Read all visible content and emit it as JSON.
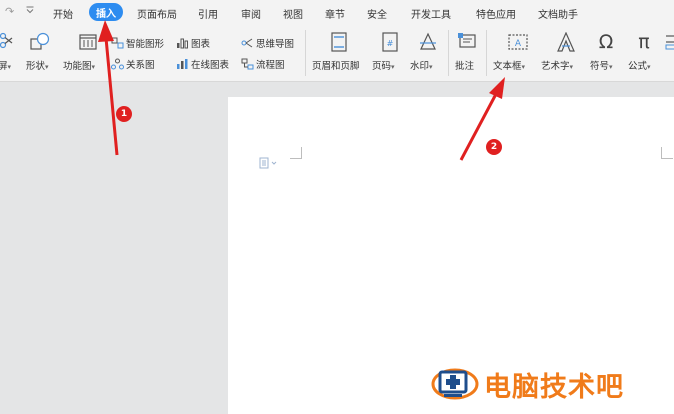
{
  "menu": {
    "items": [
      "开始",
      "插入",
      "页面布局",
      "引用",
      "审阅",
      "视图",
      "章节",
      "安全",
      "开发工具",
      "特色应用",
      "文档助手"
    ],
    "active_index": 1
  },
  "ribbon": {
    "screenshot_label": "屏",
    "shape_label": "形状",
    "function_chart_label": "功能图",
    "smart_graphic_label": "智能图形",
    "relation_label": "关系图",
    "chart_label": "图表",
    "online_chart_label": "在线图表",
    "mindmap_label": "思维导图",
    "flowchart_label": "流程图",
    "header_footer_label": "页眉和页脚",
    "page_number_label": "页码",
    "watermark_label": "水印",
    "comment_label": "批注",
    "textbox_label": "文本框",
    "wordart_label": "艺术字",
    "symbol_label": "符号",
    "formula_label": "公式",
    "dropdown_arrow": "▾"
  },
  "annotations": {
    "badge1": "1",
    "badge2": "2",
    "color": "#e02020"
  },
  "watermark": {
    "text": "电脑技术吧",
    "color": "#f07b1a"
  },
  "colors": {
    "active_tab": "#2d8cf0"
  }
}
